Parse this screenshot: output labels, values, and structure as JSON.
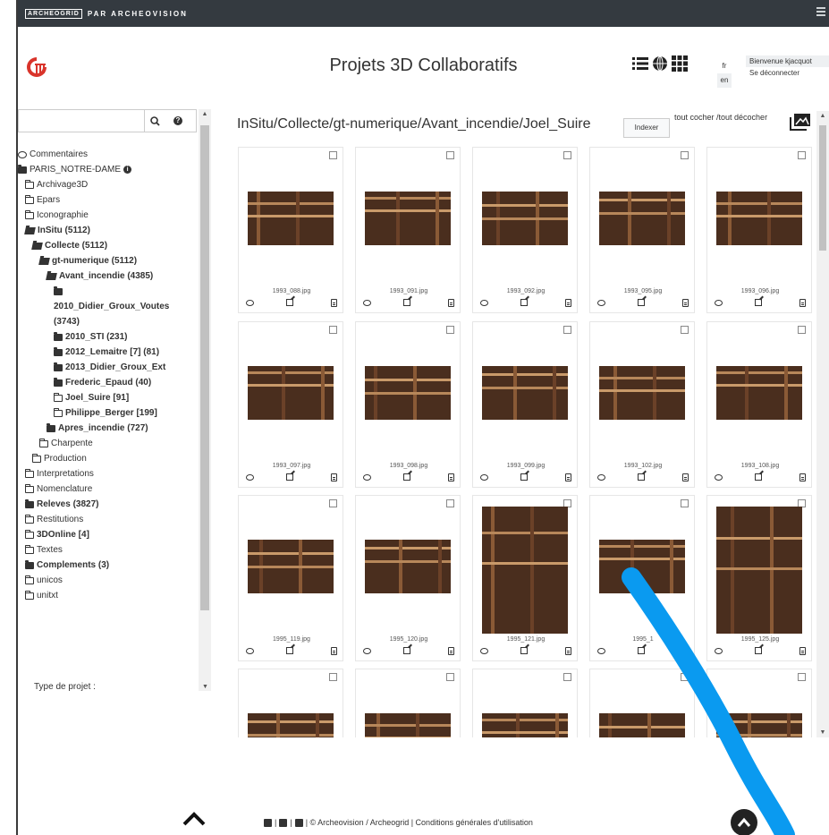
{
  "topbar": {
    "brand_box": "ARCHEOGRID",
    "brand_sub": "PAR ARCHEOVISION"
  },
  "header": {
    "title": "Projets 3D Collaboratifs",
    "lang_fr": "fr",
    "lang_en": "en",
    "welcome": "Bienvenue kjacquot",
    "logout": "Se déconnecter"
  },
  "sidebar": {
    "search_placeholder": "",
    "project_type_label": "Type de projet :",
    "tree": [
      {
        "label": "Commentaires",
        "icon": "comment-icon",
        "indent": 0,
        "bold": false
      },
      {
        "label": "PARIS_NOTRE-DAME",
        "icon": "folder-closed-icon",
        "indent": 0,
        "bold": false,
        "info": true
      },
      {
        "label": "Archivage3D",
        "icon": "folder-outline-icon",
        "indent": 1,
        "bold": false
      },
      {
        "label": "Epars",
        "icon": "folder-outline-icon",
        "indent": 1,
        "bold": false
      },
      {
        "label": "Iconographie",
        "icon": "folder-outline-icon",
        "indent": 1,
        "bold": false
      },
      {
        "label": "InSitu (5112)",
        "icon": "folder-open-icon",
        "indent": 1,
        "bold": true
      },
      {
        "label": "Collecte (5112)",
        "icon": "folder-open-icon",
        "indent": 2,
        "bold": true
      },
      {
        "label": "gt-numerique (5112)",
        "icon": "folder-open-icon",
        "indent": 3,
        "bold": true
      },
      {
        "label": "Avant_incendie (4385)",
        "icon": "folder-open-icon",
        "indent": 4,
        "bold": true
      },
      {
        "label": "",
        "icon": "folder-closed-icon",
        "indent": 5,
        "bold": true
      },
      {
        "label": "2010_Didier_Groux_Voutes",
        "icon": "",
        "indent": 5,
        "bold": true
      },
      {
        "label": "(3743)",
        "icon": "",
        "indent": 5,
        "bold": true
      },
      {
        "label": "2010_STI (231)",
        "icon": "folder-closed-icon",
        "indent": 5,
        "bold": true
      },
      {
        "label": "2012_Lemaitre [7] (81)",
        "icon": "folder-closed-icon",
        "indent": 5,
        "bold": true
      },
      {
        "label": "2013_Didier_Groux_Ext",
        "icon": "folder-closed-icon",
        "indent": 5,
        "bold": true
      },
      {
        "label": "Frederic_Epaud (40)",
        "icon": "folder-closed-icon",
        "indent": 5,
        "bold": true
      },
      {
        "label": "Joel_Suire [91]",
        "icon": "folder-outline-icon",
        "indent": 5,
        "bold": true
      },
      {
        "label": "Philippe_Berger [199]",
        "icon": "folder-outline-icon",
        "indent": 5,
        "bold": true
      },
      {
        "label": "Apres_incendie (727)",
        "icon": "folder-closed-icon",
        "indent": 4,
        "bold": true
      },
      {
        "label": "Charpente",
        "icon": "folder-outline-icon",
        "indent": 3,
        "bold": false
      },
      {
        "label": "Production",
        "icon": "folder-outline-icon",
        "indent": 2,
        "bold": false
      },
      {
        "label": "Interpretations",
        "icon": "folder-outline-icon",
        "indent": 1,
        "bold": false
      },
      {
        "label": "Nomenclature",
        "icon": "folder-outline-icon",
        "indent": 1,
        "bold": false
      },
      {
        "label": "Releves (3827)",
        "icon": "folder-closed-icon",
        "indent": 1,
        "bold": true
      },
      {
        "label": "Restitutions",
        "icon": "folder-outline-icon",
        "indent": 1,
        "bold": false
      },
      {
        "label": "3DOnline [4]",
        "icon": "folder-outline-icon",
        "indent": 1,
        "bold": true
      },
      {
        "label": "Textes",
        "icon": "folder-outline-icon",
        "indent": 1,
        "bold": false
      },
      {
        "label": "Complements (3)",
        "icon": "folder-closed-icon",
        "indent": 1,
        "bold": true
      },
      {
        "label": "unicos",
        "icon": "folder-outline-icon",
        "indent": 1,
        "bold": false
      },
      {
        "label": "unitxt",
        "icon": "folder-outline-icon",
        "indent": 1,
        "bold": false
      }
    ]
  },
  "main": {
    "path": "InSitu/Collecte/gt-numerique/Avant_incendie/Joel_Suire",
    "index_button": "Indexer",
    "check_all": "tout cocher /tout décocher",
    "files": [
      {
        "name": "1993_088.jpg",
        "shape": "landscape"
      },
      {
        "name": "1993_091.jpg",
        "shape": "landscape"
      },
      {
        "name": "1993_092.jpg",
        "shape": "landscape"
      },
      {
        "name": "1993_095.jpg",
        "shape": "landscape"
      },
      {
        "name": "1993_096.jpg",
        "shape": "landscape"
      },
      {
        "name": "1993_097.jpg",
        "shape": "landscape"
      },
      {
        "name": "1993_098.jpg",
        "shape": "landscape"
      },
      {
        "name": "1993_099.jpg",
        "shape": "landscape"
      },
      {
        "name": "1993_102.jpg",
        "shape": "landscape"
      },
      {
        "name": "1993_108.jpg",
        "shape": "landscape"
      },
      {
        "name": "1995_119.jpg",
        "shape": "landscape"
      },
      {
        "name": "1995_120.jpg",
        "shape": "landscape"
      },
      {
        "name": "1995_121.jpg",
        "shape": "portrait"
      },
      {
        "name": "1995_1",
        "shape": "landscape"
      },
      {
        "name": "1995_125.jpg",
        "shape": "portrait"
      },
      {
        "name": "",
        "shape": "landscape"
      },
      {
        "name": "",
        "shape": "landscape"
      },
      {
        "name": "",
        "shape": "landscape"
      },
      {
        "name": "",
        "shape": "landscape"
      },
      {
        "name": "",
        "shape": "landscape"
      }
    ]
  },
  "footer": {
    "text": "| © Archeovision / Archeogrid | Conditions générales d'utilisation",
    "sep1": "|"
  },
  "colors": {
    "topbar": "#343a40",
    "annotation_stroke": "#0a9af0",
    "logo_red": "#d9342b"
  }
}
